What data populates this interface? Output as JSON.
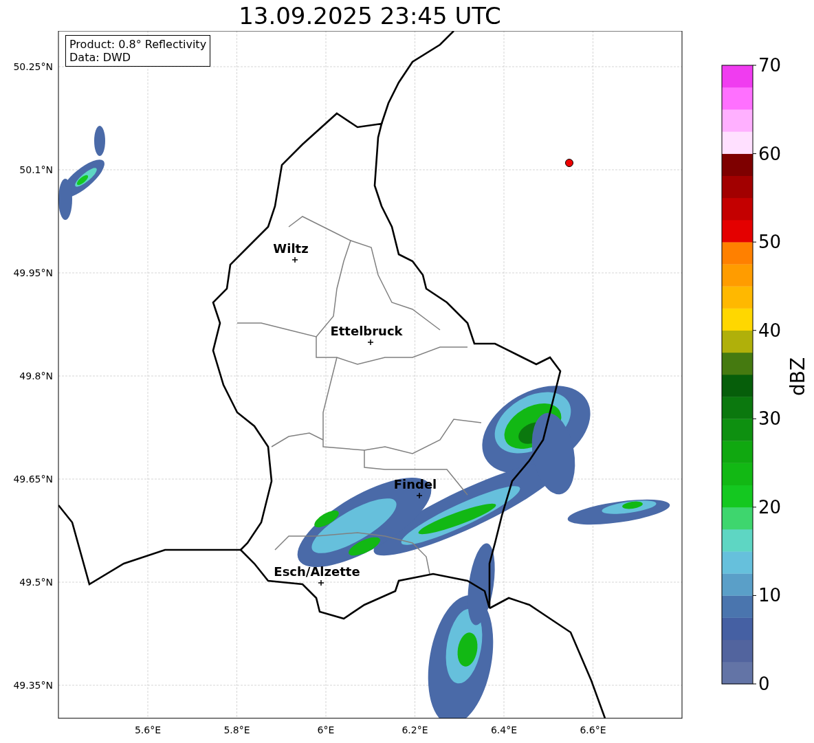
{
  "title": "13.09.2025 23:45 UTC",
  "info_box": {
    "lines": [
      "Product: 0.8° Reflectivity",
      "Data: DWD"
    ]
  },
  "map": {
    "lat_ticks": [
      "50.25°N",
      "50.1°N",
      "49.95°N",
      "49.8°N",
      "49.65°N",
      "49.5°N",
      "49.35°N"
    ],
    "lon_ticks": [
      "5.6°E",
      "5.8°E",
      "6°E",
      "6.2°E",
      "6.4°E",
      "6.6°E"
    ],
    "cities": [
      {
        "name": "Wiltz"
      },
      {
        "name": "Ettelbruck"
      },
      {
        "name": "Findel"
      },
      {
        "name": "Esch/Alzette"
      }
    ]
  },
  "colorbar": {
    "label": "dBZ",
    "ticks": [
      "70",
      "60",
      "50",
      "40",
      "30",
      "20",
      "10",
      "0"
    ],
    "bins": [
      {
        "color": "#6374a6"
      },
      {
        "color": "#52649e"
      },
      {
        "color": "#4560a3"
      },
      {
        "color": "#4a75ae"
      },
      {
        "color": "#5a9fc8"
      },
      {
        "color": "#66c0dc"
      },
      {
        "color": "#5ed6c3"
      },
      {
        "color": "#3ed66e"
      },
      {
        "color": "#14c820"
      },
      {
        "color": "#12b814"
      },
      {
        "color": "#10a810"
      },
      {
        "color": "#0e9010"
      },
      {
        "color": "#0b780e"
      },
      {
        "color": "#065e0a"
      },
      {
        "color": "#457a10"
      },
      {
        "color": "#b0b00a"
      },
      {
        "color": "#ffd700"
      },
      {
        "color": "#ffb800"
      },
      {
        "color": "#ff9c00"
      },
      {
        "color": "#ff8000"
      },
      {
        "color": "#e40000"
      },
      {
        "color": "#c40000"
      },
      {
        "color": "#a20000"
      },
      {
        "color": "#7e0000"
      },
      {
        "color": "#ffe0ff"
      },
      {
        "color": "#ffb0ff"
      },
      {
        "color": "#ff70ff"
      },
      {
        "color": "#f03cf0"
      }
    ]
  }
}
